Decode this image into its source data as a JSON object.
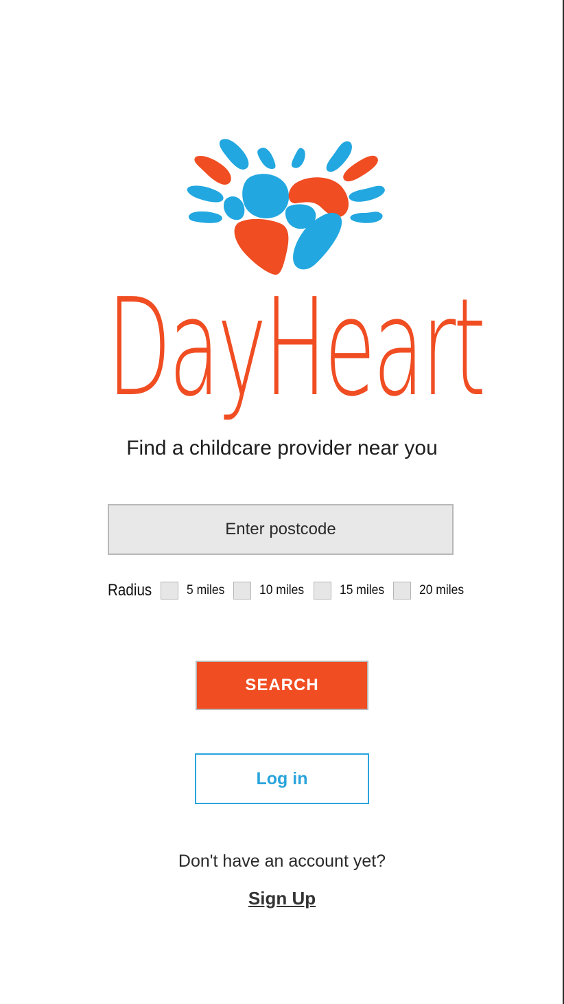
{
  "brand": {
    "name": "DayHeart",
    "primary_color": "#f04d22",
    "secondary_color": "#22a7e0",
    "logo_icon": "heart-sun-logo-icon"
  },
  "tagline": "Find a childcare provider near you",
  "postcode": {
    "placeholder": "Enter postcode",
    "value": ""
  },
  "radius": {
    "label": "Radius",
    "options": [
      {
        "label": "5 miles",
        "checked": false
      },
      {
        "label": "10 miles",
        "checked": false
      },
      {
        "label": "15 miles",
        "checked": false
      },
      {
        "label": "20 miles",
        "checked": false
      }
    ]
  },
  "search_button": {
    "label": "SEARCH"
  },
  "login_button": {
    "label": "Log in"
  },
  "signup": {
    "prompt": "Don't have an account yet?",
    "link_label": "Sign Up"
  }
}
